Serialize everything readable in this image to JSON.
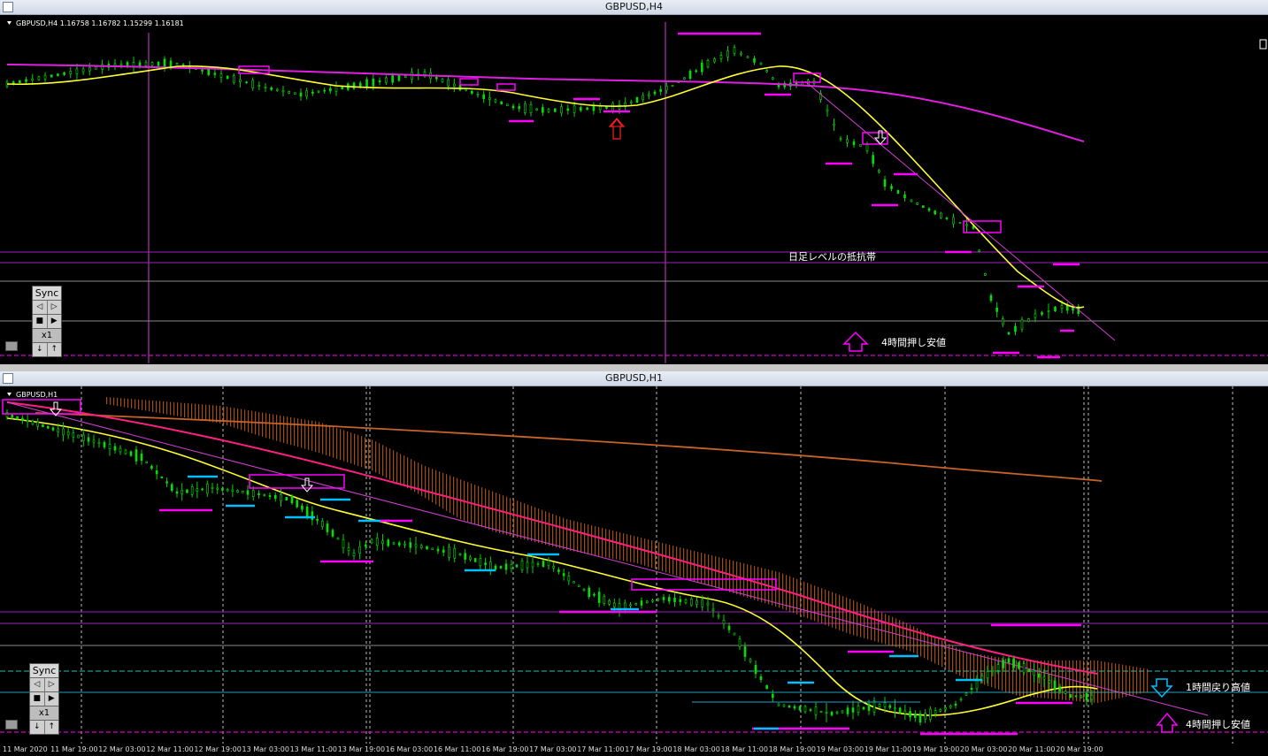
{
  "top_window": {
    "title": "GBPUSD,H4",
    "info": "GBPUSD,H4  1.16758 1.16782 1.15299 1.16181",
    "labels": {
      "resistance": "日足レベルの抵抗帯",
      "pullback_low": "4時間押し安値"
    }
  },
  "bottom_window": {
    "title": "GBPUSD,H1",
    "info": "GBPUSD,H1",
    "labels": {
      "rebound_high": "1時間戻り高値",
      "pullback_low": "4時間押し安値"
    },
    "time_axis": [
      "11 Mar 2020",
      "11 Mar 19:00",
      "12 Mar 03:00",
      "12 Mar 11:00",
      "12 Mar 19:00",
      "13 Mar 03:00",
      "13 Mar 11:00",
      "13 Mar 19:00",
      "16 Mar 03:00",
      "16 Mar 11:00",
      "16 Mar 19:00",
      "17 Mar 03:00",
      "17 Mar 11:00",
      "17 Mar 19:00",
      "18 Mar 03:00",
      "18 Mar 11:00",
      "18 Mar 19:00",
      "19 Mar 03:00",
      "19 Mar 11:00",
      "19 Mar 19:00",
      "20 Mar 03:00",
      "20 Mar 11:00",
      "20 Mar 19:00"
    ]
  },
  "sync_panel": {
    "label": "Sync",
    "speed": "x1",
    "prev": "◁",
    "next": "▷",
    "stop": "■",
    "play": "▶",
    "down": "↓",
    "up": "↑"
  },
  "colors": {
    "magenta": "#ff00ff",
    "yellow": "#ffff33",
    "green": "#00e000",
    "cyan": "#00bfff",
    "orange": "#d2691e"
  }
}
